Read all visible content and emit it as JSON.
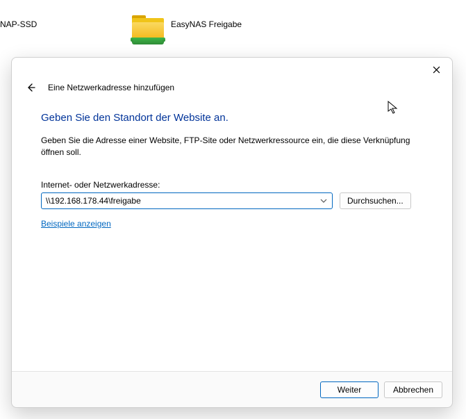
{
  "desktop": {
    "items": [
      {
        "label": "NAP-SSD"
      },
      {
        "label": "EasyNAS Freigabe"
      }
    ]
  },
  "dialog": {
    "wizard_title": "Eine Netzwerkadresse hinzufügen",
    "heading": "Geben Sie den Standort der Website an.",
    "description": "Geben Sie die Adresse einer Website, FTP-Site oder Netzwerkressource ein, die diese Verknüpfung öffnen soll.",
    "field_label": "Internet- oder Netzwerkadresse:",
    "address_value": "\\\\192.168.178.44\\freigabe",
    "browse_label": "Durchsuchen...",
    "examples_label": "Beispiele anzeigen",
    "next_label": "Weiter",
    "cancel_label": "Abbrechen"
  }
}
